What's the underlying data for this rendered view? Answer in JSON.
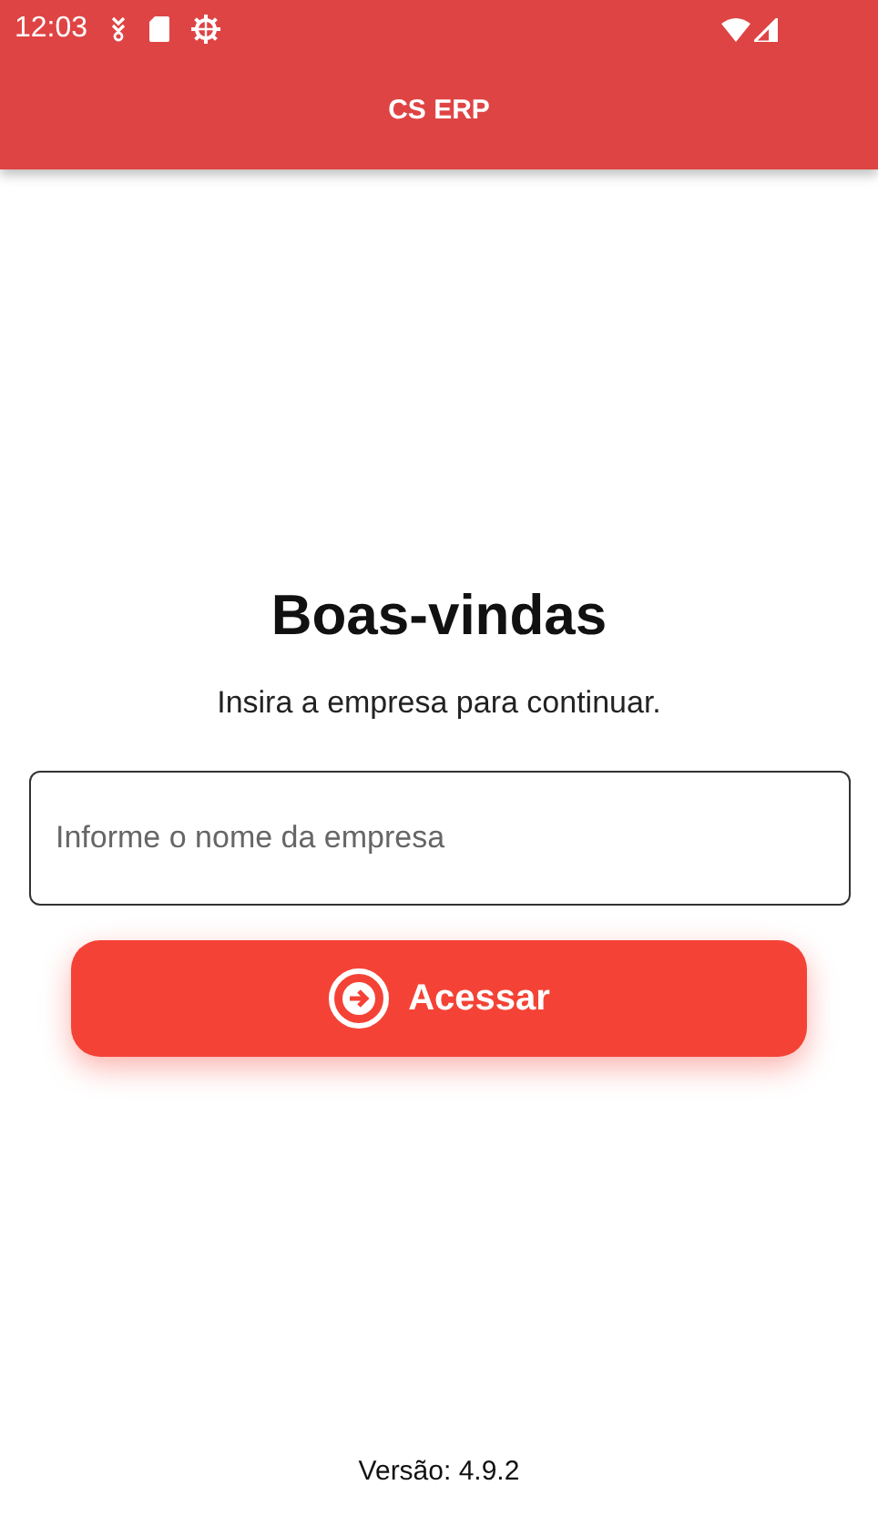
{
  "status_bar": {
    "time": "12:03"
  },
  "app_bar": {
    "title": "CS ERP"
  },
  "welcome": {
    "title": "Boas-vindas",
    "subtitle": "Insira a empresa para continuar."
  },
  "company_field": {
    "placeholder": "Informe o nome da empresa"
  },
  "access_button": {
    "label": "Acessar"
  },
  "version": "Versão: 4.9.2"
}
